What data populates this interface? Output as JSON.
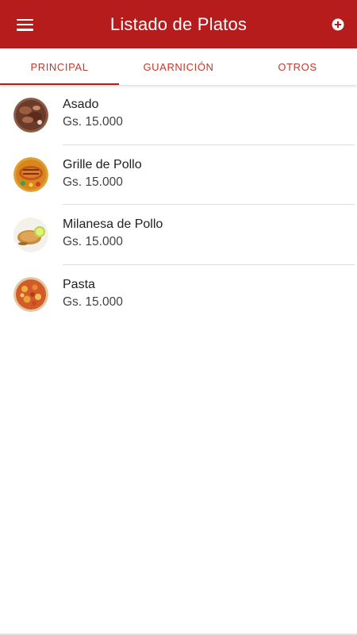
{
  "appbar": {
    "title": "Listado de Platos",
    "menu_icon": "hamburger-menu-icon",
    "add_icon": "add-circle-icon",
    "background_color": "#b71c1c"
  },
  "tabs": [
    {
      "label": "PRINCIPAL",
      "active": true
    },
    {
      "label": "GUARNICIÓN",
      "active": false
    },
    {
      "label": "OTROS",
      "active": false
    }
  ],
  "dishes": [
    {
      "name": "Asado",
      "price": "Gs. 15.000",
      "thumbnail": "asado-photo"
    },
    {
      "name": "Grille de Pollo",
      "price": "Gs. 15.000",
      "thumbnail": "grilled-chicken-photo"
    },
    {
      "name": "Milanesa de Pollo",
      "price": "Gs. 15.000",
      "thumbnail": "milanesa-photo"
    },
    {
      "name": "Pasta",
      "price": "Gs. 15.000",
      "thumbnail": "pasta-photo"
    }
  ],
  "colors": {
    "accent": "#b71c1c",
    "tab_text": "#c0392b",
    "divider": "#dcdcdc"
  }
}
